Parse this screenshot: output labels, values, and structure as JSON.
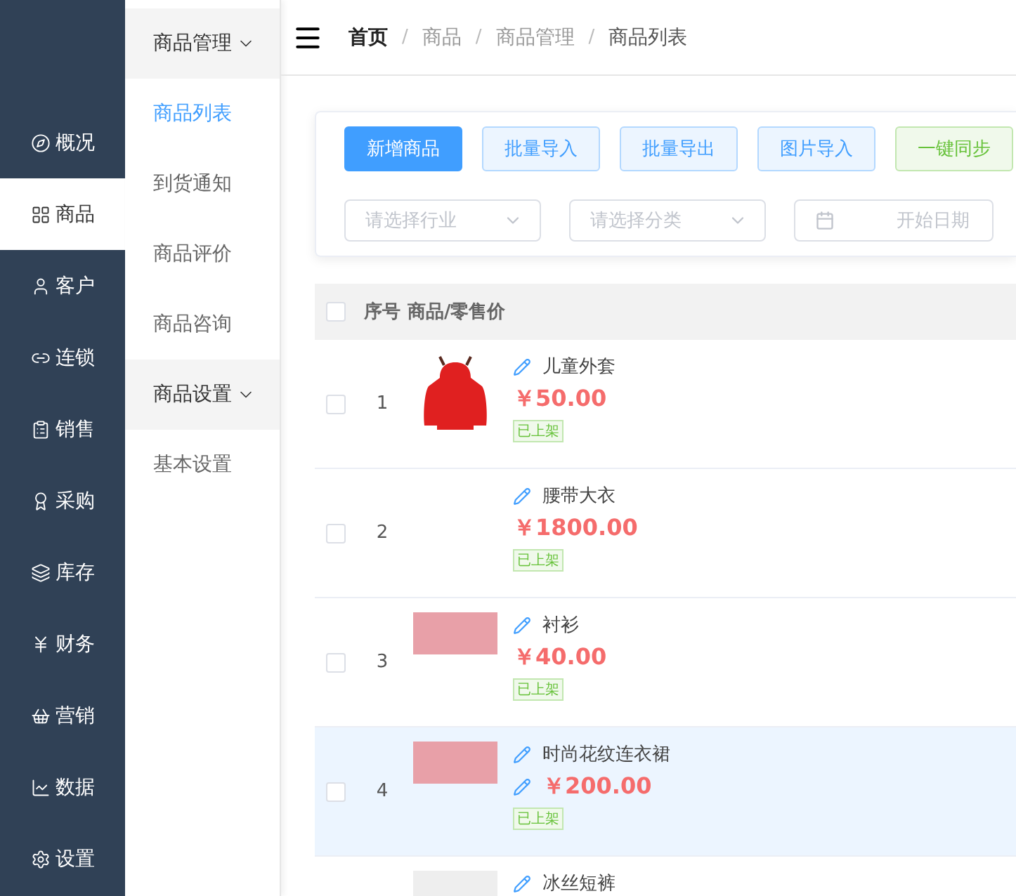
{
  "nav": {
    "items": [
      {
        "label": "概况",
        "selected": false
      },
      {
        "label": "商品",
        "selected": true
      },
      {
        "label": "客户",
        "selected": false
      },
      {
        "label": "连锁",
        "selected": false
      },
      {
        "label": "销售",
        "selected": false
      },
      {
        "label": "采购",
        "selected": false
      },
      {
        "label": "库存",
        "selected": false
      },
      {
        "label": "财务",
        "selected": false
      },
      {
        "label": "营销",
        "selected": false
      },
      {
        "label": "数据",
        "selected": false
      },
      {
        "label": "设置",
        "selected": false
      }
    ]
  },
  "submenu": {
    "groups": [
      {
        "title": "商品管理",
        "expanded": true,
        "items": [
          {
            "label": "商品列表",
            "selected": true
          },
          {
            "label": "到货通知",
            "selected": false
          },
          {
            "label": "商品评价",
            "selected": false
          },
          {
            "label": "商品咨询",
            "selected": false
          }
        ]
      },
      {
        "title": "商品设置",
        "expanded": true,
        "items": [
          {
            "label": "基本设置",
            "selected": false
          }
        ]
      }
    ]
  },
  "breadcrumb": {
    "items": [
      "首页",
      "商品",
      "商品管理",
      "商品列表"
    ],
    "separator": "/"
  },
  "toolbar": {
    "buttons": [
      {
        "label": "新增商品",
        "kind": "primary"
      },
      {
        "label": "批量导入",
        "kind": "plain"
      },
      {
        "label": "批量导出",
        "kind": "plain"
      },
      {
        "label": "图片导入",
        "kind": "plain"
      },
      {
        "label": "一键同步",
        "kind": "success"
      }
    ],
    "filters": [
      {
        "kind": "select",
        "placeholder": "请选择行业"
      },
      {
        "kind": "select",
        "placeholder": "请选择分类"
      },
      {
        "kind": "date",
        "placeholder": "开始日期"
      }
    ]
  },
  "table": {
    "columns": [
      "序号",
      "商品/零售价"
    ],
    "header_checked": false,
    "rows": [
      {
        "index": "1",
        "kind": "jacket",
        "name": "儿童外套",
        "price": "￥50.00",
        "price_editable": false,
        "tag": "已上架",
        "checked": false,
        "selected": false
      },
      {
        "index": "2",
        "kind": "text-only",
        "name": "腰带大衣",
        "price": "￥1800.00",
        "price_editable": false,
        "tag": "已上架",
        "checked": false,
        "selected": false
      },
      {
        "index": "3",
        "kind": "photo",
        "name": "衬衫",
        "price": "￥40.00",
        "price_editable": false,
        "tag": "已上架",
        "checked": false,
        "selected": false
      },
      {
        "index": "4",
        "kind": "photo",
        "name": "时尚花纹连衣裙",
        "price": "￥200.00",
        "price_editable": true,
        "tag": "已上架",
        "checked": false,
        "selected": true
      },
      {
        "kind": "photo-light",
        "name": "冰丝短裤",
        "selected": false
      }
    ]
  }
}
